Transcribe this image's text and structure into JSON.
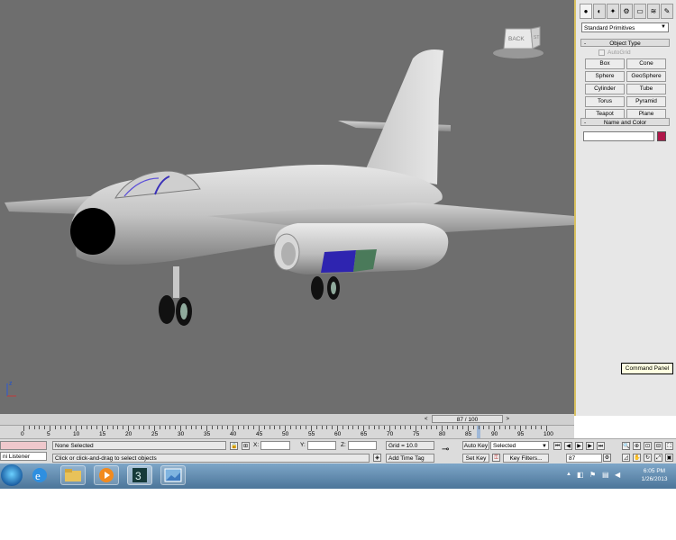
{
  "viewport": {
    "viewcube_label": "BACK",
    "viewcube_side": "ST",
    "axis_label": "z"
  },
  "command_panel": {
    "tabs": [
      "create-tab",
      "modify-tab",
      "hierarchy-tab",
      "motion-tab",
      "display-tab",
      "utilities-tab",
      "extra-tab"
    ],
    "dropdown_value": "Standard Primitives",
    "object_type_title": "Object Type",
    "autogrid_label": "AutoGrid",
    "buttons": [
      "Box",
      "Cone",
      "Sphere",
      "GeoSphere",
      "Cylinder",
      "Tube",
      "Torus",
      "Pyramid",
      "Teapot",
      "Plane"
    ],
    "name_color_title": "Name and Color",
    "color": "#b0174a",
    "tooltip": "Command Panel"
  },
  "timeline": {
    "slider_label": "87 / 100",
    "frame": 87,
    "total": 100,
    "ticks": [
      "0",
      "5",
      "10",
      "15",
      "20",
      "25",
      "30",
      "35",
      "40",
      "45",
      "50",
      "55",
      "60",
      "65",
      "70",
      "75",
      "80",
      "85",
      "90",
      "95",
      "100"
    ]
  },
  "status": {
    "listener": "ni Listener",
    "selection": "None Selected",
    "prompt": "Click or click-and-drag to select objects",
    "x_label": "X:",
    "y_label": "Y:",
    "z_label": "Z:",
    "grid": "Grid = 10.0",
    "add_time_tag": "Add Time Tag",
    "auto_key": "Auto Key",
    "selected_value": "Selected",
    "set_key": "Set Key",
    "key_filters": "Key Filters...",
    "frame_field": "87"
  },
  "taskbar": {
    "items": [
      "explorer",
      "media-player",
      "3dsmax",
      "image-viewer"
    ],
    "time": "6:05 PM",
    "date": "1/26/2013"
  }
}
